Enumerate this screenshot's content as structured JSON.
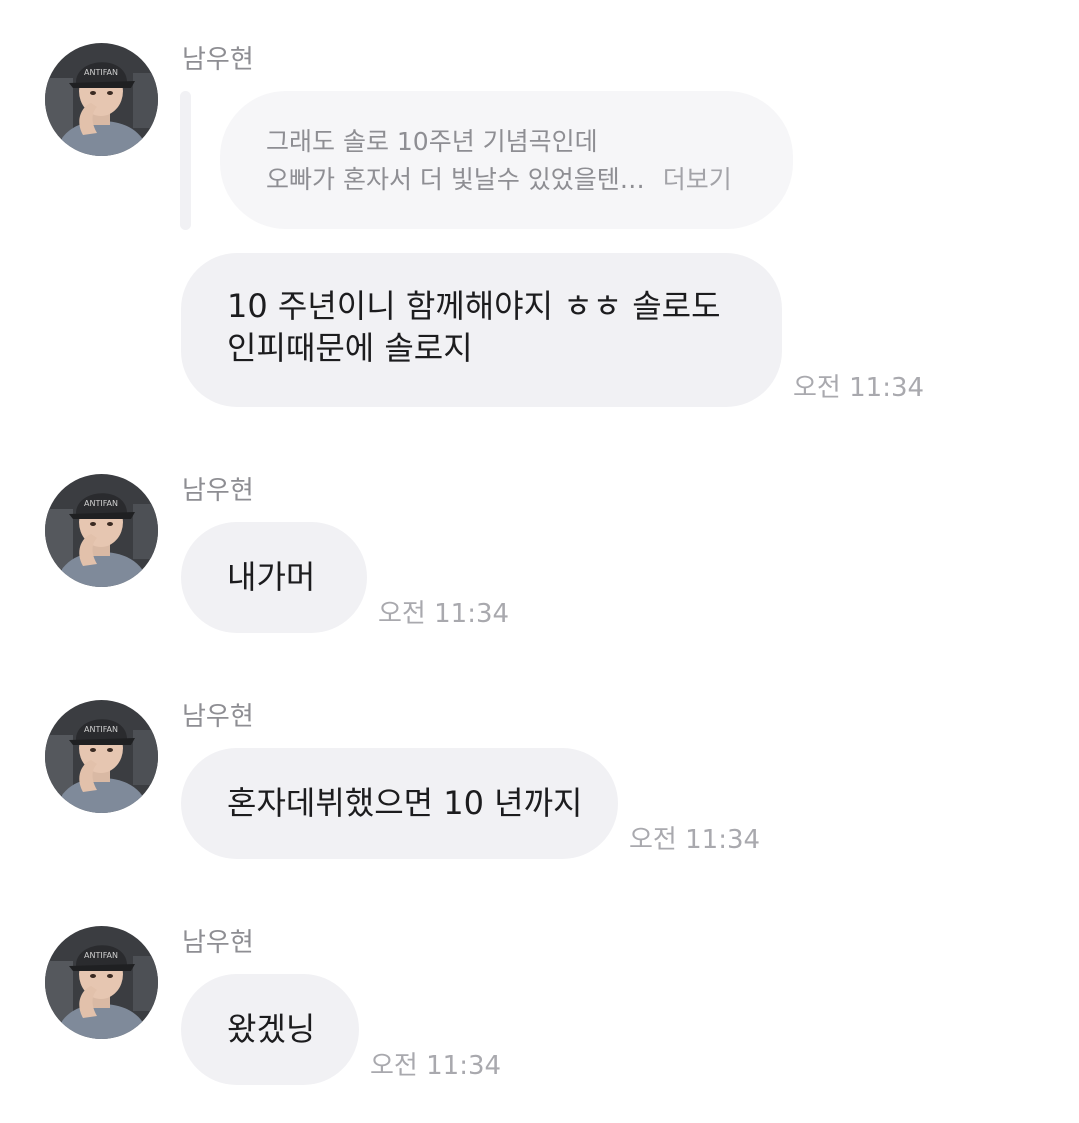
{
  "messages": [
    {
      "sender": "남우현",
      "reply_quote": {
        "lines": [
          "그래도 솔로 10주년 기념곡인데",
          "오빠가 혼자서 더 빛날수 있었을텐…"
        ],
        "more_label": "더보기"
      },
      "lines": [
        "10 주년이니 함께해야지 ㅎㅎ 솔로도",
        "인피때문에 솔로지"
      ],
      "time": "오전 11:34"
    },
    {
      "sender": "남우현",
      "lines": [
        "내가머"
      ],
      "time": "오전 11:34"
    },
    {
      "sender": "남우현",
      "lines": [
        "혼자데뷔했으면 10 년까지"
      ],
      "time": "오전 11:34"
    },
    {
      "sender": "남우현",
      "lines": [
        "왔겠닝"
      ],
      "time": "오전 11:34"
    }
  ],
  "colors": {
    "bubble": "#f1f1f4",
    "quote_bubble": "#f6f6f8",
    "muted_text": "#8e8e93",
    "body_text": "#1c1c1e"
  },
  "icons": {
    "avatar": "profile-photo"
  }
}
